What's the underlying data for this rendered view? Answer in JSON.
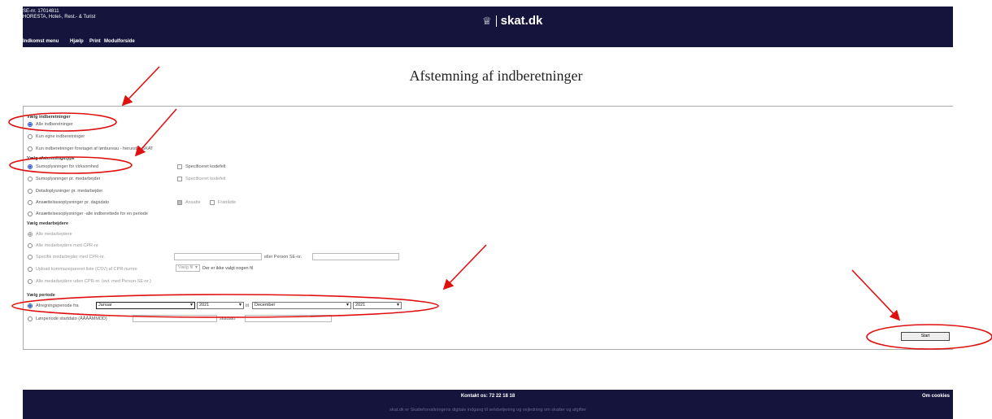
{
  "header": {
    "se_number": "SE-nr. 17014811",
    "company": "HORESTA, Hotel-, Rest.- & Turist",
    "logo_text": "skat.dk",
    "logo_icon": "crown-icon"
  },
  "menu": {
    "items": [
      "Indkomst menu",
      "Hjælp",
      "Print",
      "Modulforside"
    ]
  },
  "page": {
    "title": "Afstemning af indberetninger"
  },
  "sections": {
    "reports": {
      "heading": "Vælg indberetninger",
      "options": [
        "Alle indberetninger",
        "Kun egne indberetninger",
        "Kun indberetninger foretaget af lønbureau - herunder SKAT"
      ]
    },
    "reporttype": {
      "heading": "Vælg afstemningstype",
      "options": [
        "Sumoplysninger for virksomhed",
        "Sumoplysninger pr. medarbejder",
        "Detailoplysninger pr. medarbejder",
        "Ansættelsesoplysninger pr. dagsdato",
        "Ansættelsesoplysninger -alle indberettede for en periode"
      ],
      "spec_label": "Specificeret kodefelt",
      "ansatte_label": "Ansatte",
      "fratraadte_label": "Fratrådte"
    },
    "employees": {
      "heading": "Vælg medarbejdere",
      "options": [
        "Alle medarbejdere",
        "Alle medarbejdere med CPR-nr.",
        "Specifik medarbejder med CPR-nr.",
        "Upload kommasepareret liste (CSV) af CPR-numre",
        "Alle medarbejdere uden CPR-nr. (evt. med Person-SE-nr.)"
      ],
      "person_se_label": "eller Person SE-nr.",
      "choose_file_label": "Vælg fil",
      "no_file_label": "Der er ikke valgt nogen fil"
    },
    "period": {
      "heading": "Vælg periode",
      "option1": "Afregningsperiode fra",
      "from_month": "Januar",
      "from_year": "2021",
      "to_label": "til",
      "to_month": "December",
      "to_year": "2021",
      "option2": "Lønperiode startdato (ÅÅÅÅMMDD)",
      "slut_label": "slutdato"
    },
    "start_label": "Start"
  },
  "footer": {
    "contact": "Kontakt os: 72 22 18 18",
    "cookies": "Om cookies",
    "disclaimer": "skat.dk er Skatteforvaltningens digitale indgang til selvbetjening og vejledning om skatter og afgifter"
  },
  "colors": {
    "header_bg": "#14143c",
    "annotation": "#e01010",
    "radio_selected": "#2a55c4"
  }
}
